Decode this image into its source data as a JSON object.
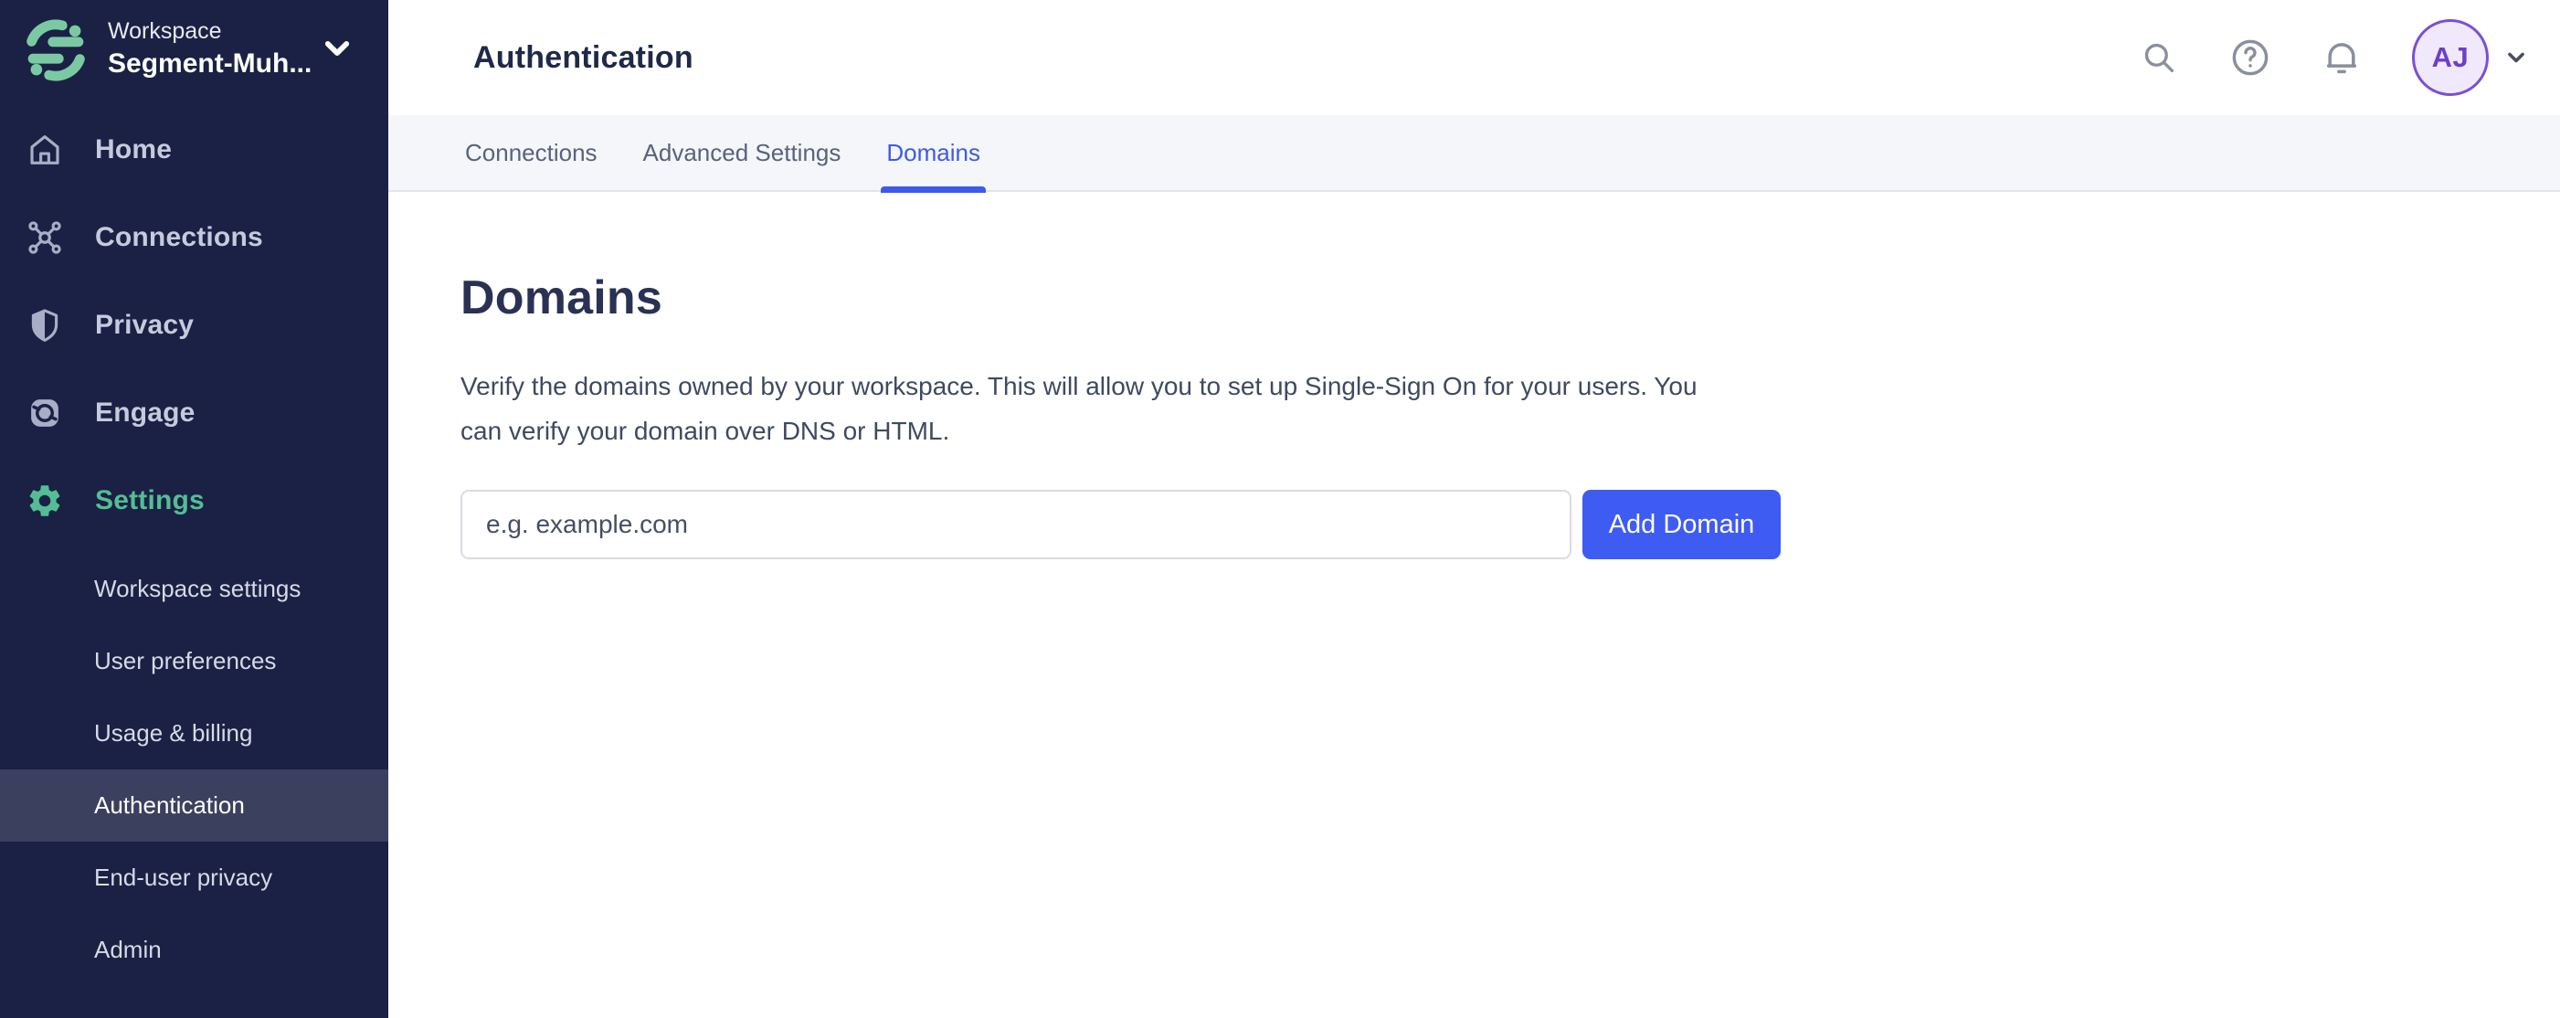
{
  "workspace": {
    "label": "Workspace",
    "name": "Segment-Muh..."
  },
  "sidebar": {
    "items": [
      {
        "label": "Home",
        "icon": "home-icon"
      },
      {
        "label": "Connections",
        "icon": "connections-icon"
      },
      {
        "label": "Privacy",
        "icon": "shield-icon"
      },
      {
        "label": "Engage",
        "icon": "engage-icon"
      },
      {
        "label": "Settings",
        "icon": "gear-icon",
        "active": true
      }
    ],
    "sub_items": [
      {
        "label": "Workspace settings"
      },
      {
        "label": "User preferences"
      },
      {
        "label": "Usage & billing"
      },
      {
        "label": "Authentication",
        "active": true
      },
      {
        "label": "End-user privacy"
      },
      {
        "label": "Admin"
      }
    ]
  },
  "header": {
    "title": "Authentication",
    "tabs": [
      {
        "label": "Connections"
      },
      {
        "label": "Advanced Settings"
      },
      {
        "label": "Domains",
        "active": true
      }
    ]
  },
  "topbar": {
    "user_initials": "AJ"
  },
  "main": {
    "heading": "Domains",
    "description": "Verify the domains owned by your workspace. This will allow you to set up Single-Sign On for your users. You can verify your domain over DNS or HTML.",
    "domain_input_placeholder": "e.g. example.com",
    "add_domain_button": "Add Domain"
  },
  "colors": {
    "sidebar_bg": "#1A2144",
    "accent_green": "#55BD95",
    "logo_green": "#7BC9A3",
    "active_blue": "#3D5AE8",
    "button_blue": "#3E5BF2",
    "avatar_purple": "#6C3FC9",
    "avatar_bg": "#EFE9FB"
  }
}
